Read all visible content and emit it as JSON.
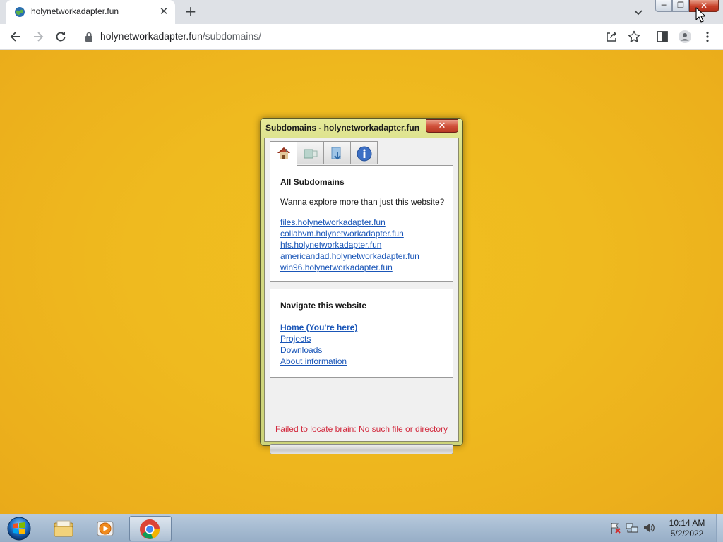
{
  "browser": {
    "tab_title": "holynetworkadapter.fun",
    "tab_close_glyph": "✕",
    "new_tab_glyph": "+",
    "url_host": "holynetworkadapter.fun",
    "url_path": "/subdomains/",
    "window_buttons": {
      "minimize": "─",
      "restore": "❐",
      "close": "✕"
    },
    "toolbar_icons": [
      "back-arrow-icon",
      "forward-arrow-icon",
      "reload-icon",
      "share-icon",
      "star-bookmark-icon",
      "side-panel-icon",
      "profile-avatar-icon",
      "menu-kebab-icon"
    ]
  },
  "dialog": {
    "title": "Subdomains - holynetworkadapter.fun",
    "close_glyph": "✕",
    "tabs": [
      {
        "icon": "home-icon",
        "active": true
      },
      {
        "icon": "projects-icon",
        "active": false
      },
      {
        "icon": "downloads-icon",
        "active": false
      },
      {
        "icon": "info-icon",
        "active": false
      }
    ],
    "subdomains": {
      "heading": "All Subdomains",
      "text": "Wanna explore more than just this website?",
      "links": [
        "files.holynetworkadapter.fun",
        "collabvm.holynetworkadapter.fun",
        "hfs.holynetworkadapter.fun",
        "americandad.holynetworkadapter.fun",
        "win96.holynetworkadapter.fun"
      ]
    },
    "navigate": {
      "heading": "Navigate this website",
      "links": [
        "Home (You're here)",
        "Projects",
        "Downloads",
        "About information"
      ]
    },
    "error": "Failed to locate brain: No such file or directory",
    "progress": 0
  },
  "taskbar": {
    "apps": [
      "explorer-folder-icon",
      "media-player-icon",
      "chrome-icon"
    ],
    "active_app": "chrome-icon",
    "tray_icons": [
      "action-center-flag-icon",
      "network-icon",
      "volume-icon"
    ],
    "time": "10:14 AM",
    "date": "5/2/2022"
  },
  "colors": {
    "page_background": "#efba1f",
    "link": "#1a56b8",
    "error": "#d2283c",
    "dialog_frame": "#d6dc84"
  }
}
